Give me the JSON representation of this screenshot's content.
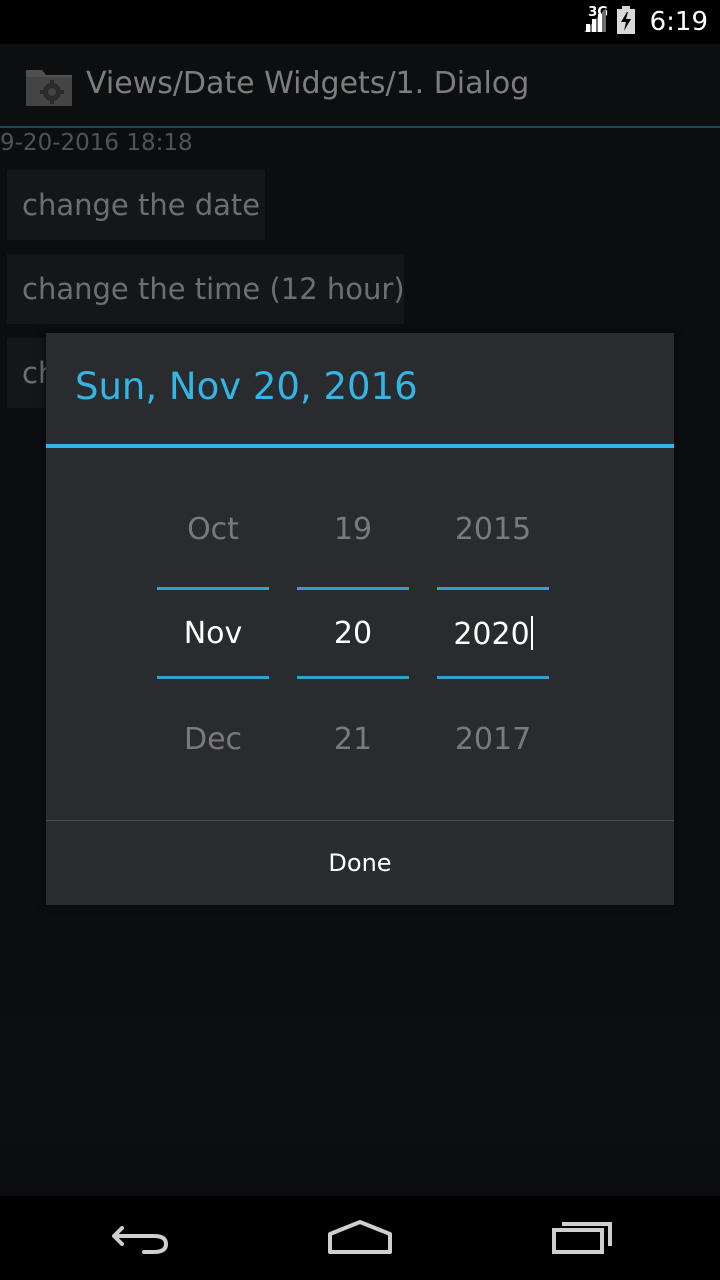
{
  "status_bar": {
    "network": "3G",
    "time": "6:19"
  },
  "action_bar": {
    "title": "Views/Date Widgets/1. Dialog",
    "icon": "settings-folder-icon"
  },
  "content": {
    "current_datetime": "9-20-2016 18:18",
    "buttons": [
      "change the date",
      "change the time (12 hour)",
      "ch"
    ]
  },
  "dialog": {
    "title": "Sun, Nov 20, 2016",
    "month": {
      "prev": "Oct",
      "current": "Nov",
      "next": "Dec"
    },
    "day": {
      "prev": "19",
      "current": "20",
      "next": "21"
    },
    "year": {
      "prev": "2015",
      "current": "2020",
      "next": "2017"
    },
    "done_label": "Done"
  },
  "colors": {
    "accent": "#33b5e5",
    "dialog_bg": "#292b2e",
    "app_bg": "#16181c"
  },
  "nav_bar": {
    "icons": [
      "back-icon",
      "home-icon",
      "recents-icon"
    ]
  }
}
